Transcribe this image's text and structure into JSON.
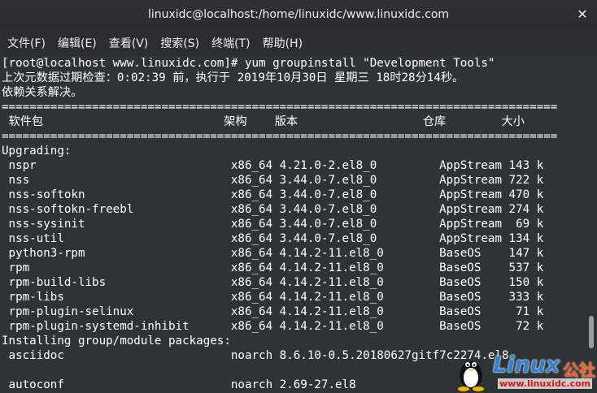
{
  "window": {
    "title": "linuxidc@localhost:/home/linuxidc/www.linuxidc.com",
    "close_glyph": "✕"
  },
  "menu": [
    {
      "label": "文件(F)"
    },
    {
      "label": "编辑(E)"
    },
    {
      "label": "查看(V)"
    },
    {
      "label": "搜索(S)"
    },
    {
      "label": "终端(T)"
    },
    {
      "label": "帮助(H)"
    }
  ],
  "terminal": {
    "lines": [
      "[root@localhost www.linuxidc.com]# yum groupinstall \"Development Tools\"",
      "上次元数据过期检查：0:02:39 前，执行于 2019年10月30日 星期三 18时28分14秒。",
      "依赖关系解决。",
      "================================================================================",
      " 软件包                          架构    版本                  仓库        大小",
      "================================================================================",
      "Upgrading:",
      " nspr                            x86_64 4.21.0-2.el8_0         AppStream 143 k",
      " nss                             x86_64 3.44.0-7.el8_0         AppStream 722 k",
      " nss-softokn                     x86_64 3.44.0-7.el8_0         AppStream 470 k",
      " nss-softokn-freebl              x86_64 3.44.0-7.el8_0         AppStream 274 k",
      " nss-sysinit                     x86_64 3.44.0-7.el8_0         AppStream  69 k",
      " nss-util                        x86_64 3.44.0-7.el8_0         AppStream 134 k",
      " python3-rpm                     x86_64 4.14.2-11.el8_0        BaseOS    147 k",
      " rpm                             x86_64 4.14.2-11.el8_0        BaseOS    537 k",
      " rpm-build-libs                  x86_64 4.14.2-11.el8_0        BaseOS    150 k",
      " rpm-libs                        x86_64 4.14.2-11.el8_0        BaseOS    333 k",
      " rpm-plugin-selinux              x86_64 4.14.2-11.el8_0        BaseOS     71 k",
      " rpm-plugin-systemd-inhibit      x86_64 4.14.2-11.el8_0        BaseOS     72 k",
      "Installing group/module packages:",
      " asciidoc                        noarch 8.6.10-0.5.20180627gitf7c2274.el8",
      "",
      " autoconf                        noarch 2.69-27.el8"
    ]
  },
  "watermark": {
    "brand": "Linux",
    "suffix": "公社",
    "url": "www.linuxidc.com"
  }
}
